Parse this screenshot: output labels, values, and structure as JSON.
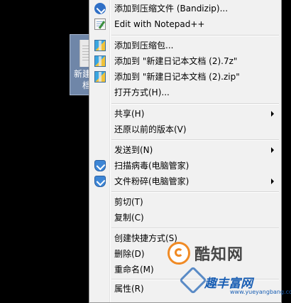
{
  "desktop": {
    "icon_label_line1": "新建",
    "icon_label_line2": "档"
  },
  "menu": {
    "items": [
      {
        "label": "添加到压缩文件 (Bandizip)...",
        "icon": "bandizip-icon",
        "submenu": false
      },
      {
        "label": "Edit with Notepad++",
        "icon": "notepad-plus-plus-icon",
        "submenu": false
      },
      {
        "label": "添加到压缩包...",
        "icon": "archive-icon",
        "submenu": false
      },
      {
        "label": "添加到 \"新建日记本文档 (2).7z\"",
        "icon": "archive-icon",
        "submenu": false
      },
      {
        "label": "添加到 \"新建日记本文档 (2).zip\"",
        "icon": "archive-icon",
        "submenu": false
      },
      {
        "label": "打开方式(H)...",
        "icon": "",
        "submenu": false
      },
      {
        "label": "共享(H)",
        "icon": "",
        "submenu": true
      },
      {
        "label": "还原以前的版本(V)",
        "icon": "",
        "submenu": false
      },
      {
        "label": "发送到(N)",
        "icon": "",
        "submenu": true
      },
      {
        "label": "扫描病毒(电脑管家)",
        "icon": "shield-icon",
        "submenu": false
      },
      {
        "label": "文件粉碎(电脑管家)",
        "icon": "shield-icon",
        "submenu": true
      },
      {
        "label": "剪切(T)",
        "icon": "",
        "submenu": false
      },
      {
        "label": "复制(C)",
        "icon": "",
        "submenu": false
      },
      {
        "label": "创建快捷方式(S)",
        "icon": "",
        "submenu": false
      },
      {
        "label": "删除(D)",
        "icon": "",
        "submenu": false
      },
      {
        "label": "重命名(M)",
        "icon": "",
        "submenu": false
      },
      {
        "label": "属性(R)",
        "icon": "",
        "submenu": false
      }
    ]
  },
  "watermark": {
    "title": "酷知网",
    "site": "趣丰富网",
    "url": "www.yueyangbang.com"
  }
}
